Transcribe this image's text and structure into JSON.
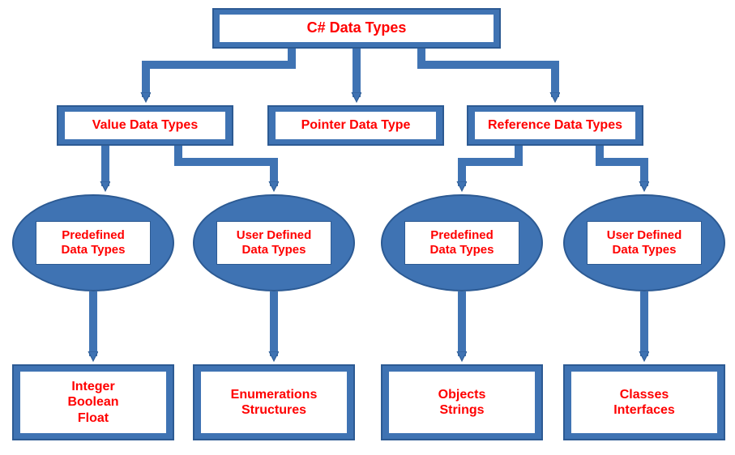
{
  "chart_data": {
    "type": "tree",
    "root": {
      "label": "C# Data Types",
      "children": [
        {
          "label": "Value Data Types",
          "children": [
            {
              "label": "Predefined Data Types",
              "shape": "ellipse",
              "children": [
                {
                  "label": "Integer\nBoolean\nFloat",
                  "shape": "box"
                }
              ]
            },
            {
              "label": "User Defined Data Types",
              "shape": "ellipse",
              "children": [
                {
                  "label": "Enumerations\nStructures",
                  "shape": "box"
                }
              ]
            }
          ]
        },
        {
          "label": "Pointer Data Type",
          "children": []
        },
        {
          "label": "Reference Data Types",
          "children": [
            {
              "label": "Predefined Data Types",
              "shape": "ellipse",
              "children": [
                {
                  "label": "Objects\nStrings",
                  "shape": "box"
                }
              ]
            },
            {
              "label": "User Defined Data Types",
              "shape": "ellipse",
              "children": [
                {
                  "label": "Classes\nInterfaces",
                  "shape": "box"
                }
              ]
            }
          ]
        }
      ]
    }
  },
  "labels": {
    "root": "C# Data Types",
    "value": "Value Data Types",
    "pointer": "Pointer Data Type",
    "reference": "Reference Data Types",
    "predef1": "Predefined\nData Types",
    "userdef1": "User Defined\nData Types",
    "predef2": "Predefined\nData Types",
    "userdef2": "User Defined\nData Types",
    "leaf1": "Integer\nBoolean\nFloat",
    "leaf2": "Enumerations\nStructures",
    "leaf3": "Objects\nStrings",
    "leaf4": "Classes\nInterfaces"
  },
  "colors": {
    "fill": "#3f73b3",
    "stroke": "#2c5a93",
    "text": "#ff0000"
  }
}
